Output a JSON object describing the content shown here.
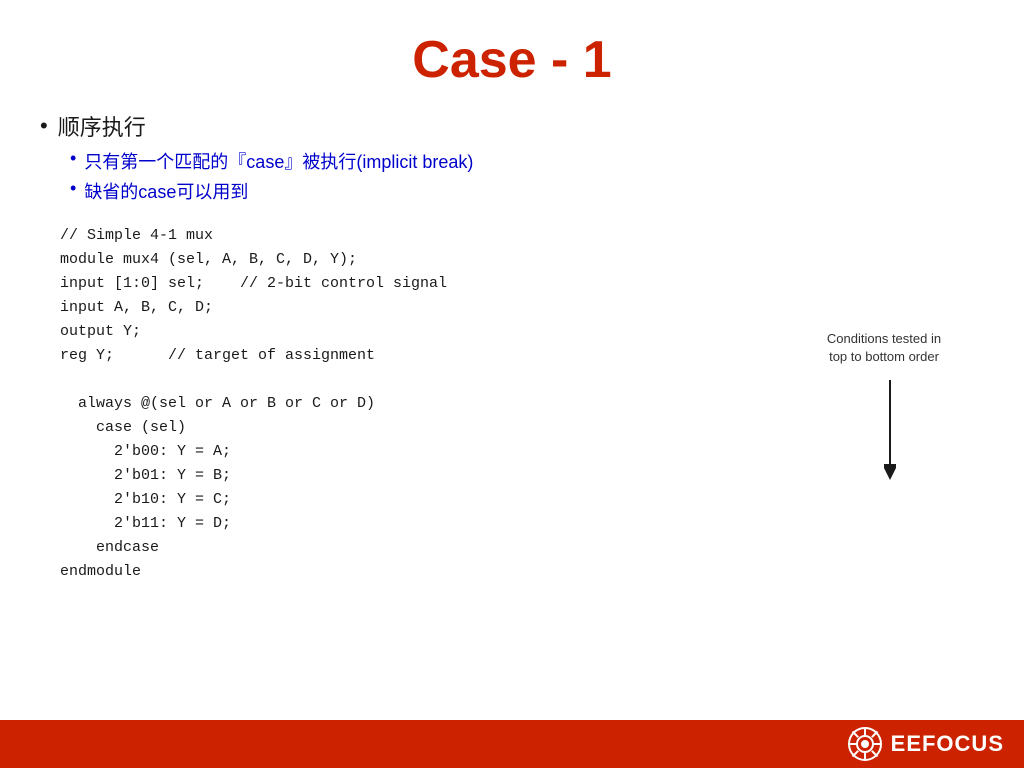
{
  "title": "Case - 1",
  "bullets": {
    "main": "顺序执行",
    "sub1": "只有第一个匹配的『case』被执行(implicit break)",
    "sub2": "缺省的case可以用到"
  },
  "code": {
    "line1": "// Simple 4-1 mux",
    "line2": "module mux4 (sel, A, B, C, D, Y);",
    "line3": "input [1:0] sel;    // 2-bit control signal",
    "line4": "input A, B, C, D;",
    "line5": "output Y;",
    "line6": "reg Y;      // target of assignment",
    "line7": "",
    "line8": "  always @(sel or A or B or C or D)",
    "line9": "    case (sel)",
    "line10": "      2'b00: Y = A;",
    "line11": "      2'b01: Y = B;",
    "line12": "      2'b10: Y = C;",
    "line13": "      2'b11: Y = D;",
    "line14": "    endcase",
    "line15": "endmodule"
  },
  "conditions_label": "Conditions tested in\ntop to bottom order",
  "logo_text": "EEFOCUS",
  "bottom_bar_color": "#CC2200"
}
